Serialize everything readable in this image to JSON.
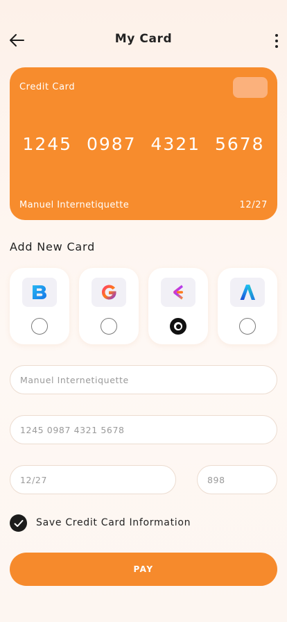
{
  "header": {
    "title": "My Card"
  },
  "card": {
    "type_label": "Credit Card",
    "number_groups": [
      "1245",
      "0987",
      "4321",
      "5678"
    ],
    "holder": "Manuel Internetiquette",
    "expiry": "12/27",
    "color": "#f78c2d"
  },
  "add_card": {
    "title": "Add New Card",
    "methods": [
      {
        "icon": "b-logo-icon",
        "selected": false
      },
      {
        "icon": "g-logo-icon",
        "selected": false
      },
      {
        "icon": "e-logo-icon",
        "selected": true
      },
      {
        "icon": "a-logo-icon",
        "selected": false
      }
    ]
  },
  "form": {
    "name_placeholder": "Manuel Internetiquette",
    "number_placeholder": "1245 0987 4321 5678",
    "expiry_placeholder": "12/27",
    "cvv_placeholder": "898",
    "save_label": "Save Credit Card Information",
    "save_checked": true
  },
  "pay_button": {
    "label": "PAY",
    "color": "#f68a2c"
  }
}
